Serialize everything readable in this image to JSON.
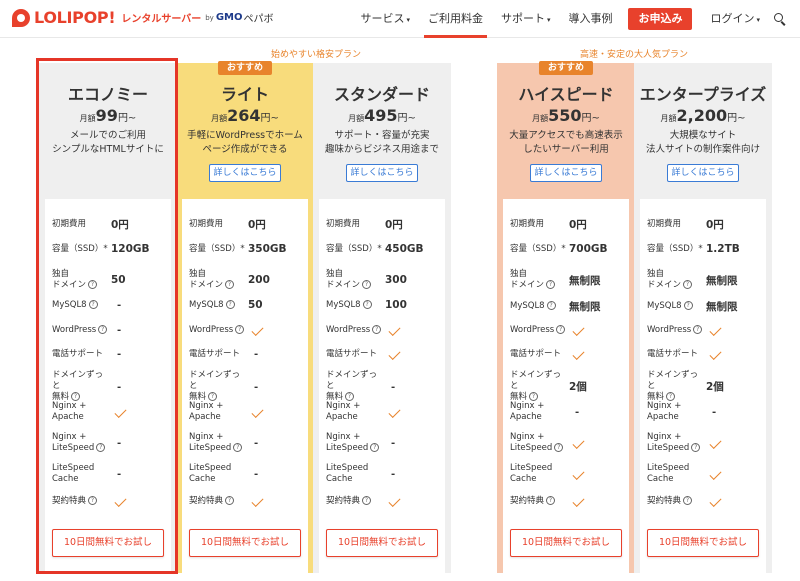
{
  "header": {
    "logo_text": "LOLIPOP!",
    "logo_sub": "レンタルサーバー",
    "logo_by": "by",
    "logo_gmo": "GMO",
    "logo_pepabo": "ペパボ",
    "nav": [
      {
        "label": "サービス",
        "caret": "▾"
      },
      {
        "label": "ご利用料金",
        "caret": ""
      },
      {
        "label": "サポート",
        "caret": "▾"
      },
      {
        "label": "導入事例",
        "caret": ""
      }
    ],
    "apply_label": "お申込み",
    "login_label": "ログイン",
    "login_caret": "▾"
  },
  "groups": {
    "left": "始めやすい格安プラン",
    "right": "高速・安定の大人気プラン"
  },
  "features": {
    "initial": "初期費用",
    "capacity": "容量（SSD）*",
    "domain": "独自\nドメイン",
    "mysql": "MySQL8",
    "wordpress": "WordPress",
    "phone": "電話サポート",
    "domain_free": "ドメインずっと\n無料",
    "nginx_apache": "Nginx +\nApache",
    "nginx_litespeed": "Nginx +\nLiteSpeed",
    "litespeed_cache": "LiteSpeed\nCache",
    "benefit": "契約特典"
  },
  "help_glyph": "?",
  "dash_glyph": "-",
  "price_pre": "月額",
  "price_post": "円~",
  "badge_label": "おすすめ",
  "detail_label": "詳しくはこちら",
  "trial_label": "10日間無料でお試し",
  "colors": {
    "accent": "#e8412c",
    "orange": "#e8842c",
    "yellow": "#f8dc7c",
    "salmon": "#f6c7ae",
    "gray": "#efefef",
    "link": "#3a7bd5"
  },
  "plans": [
    {
      "name": "エコノミー",
      "price": "99",
      "desc": "メールでのご利用\nシンプルなHTMLサイトに",
      "initial": "0円",
      "capacity": "120GB",
      "domain": "50",
      "mysql": "-",
      "wordpress": "-",
      "phone": "-",
      "domain_free": "-",
      "nginx_apache": "check",
      "nginx_litespeed": "-",
      "litespeed_cache": "-",
      "benefit": "check"
    },
    {
      "name": "ライト",
      "price": "264",
      "desc": "手軽にWordPressでホーム\nページ作成ができる",
      "initial": "0円",
      "capacity": "350GB",
      "domain": "200",
      "mysql": "50",
      "wordpress": "check",
      "phone": "-",
      "domain_free": "-",
      "nginx_apache": "check",
      "nginx_litespeed": "-",
      "litespeed_cache": "-",
      "benefit": "check"
    },
    {
      "name": "スタンダード",
      "price": "495",
      "desc": "サポート・容量が充実\n趣味からビジネス用途まで",
      "initial": "0円",
      "capacity": "450GB",
      "domain": "300",
      "mysql": "100",
      "wordpress": "check",
      "phone": "check",
      "domain_free": "-",
      "nginx_apache": "check",
      "nginx_litespeed": "-",
      "litespeed_cache": "-",
      "benefit": "check"
    },
    {
      "name": "ハイスピード",
      "price": "550",
      "desc": "大量アクセスでも高速表示\nしたいサーバー利用",
      "initial": "0円",
      "capacity": "700GB",
      "domain": "無制限",
      "mysql": "無制限",
      "wordpress": "check",
      "phone": "check",
      "domain_free": "2個",
      "nginx_apache": "-",
      "nginx_litespeed": "check",
      "litespeed_cache": "check",
      "benefit": "check"
    },
    {
      "name": "エンタープライズ",
      "price": "2,200",
      "desc": "大規模なサイト\n法人サイトの制作案件向け",
      "initial": "0円",
      "capacity": "1.2TB",
      "domain": "無制限",
      "mysql": "無制限",
      "wordpress": "check",
      "phone": "check",
      "domain_free": "2個",
      "nginx_apache": "-",
      "nginx_litespeed": "check",
      "litespeed_cache": "check",
      "benefit": "check"
    }
  ]
}
